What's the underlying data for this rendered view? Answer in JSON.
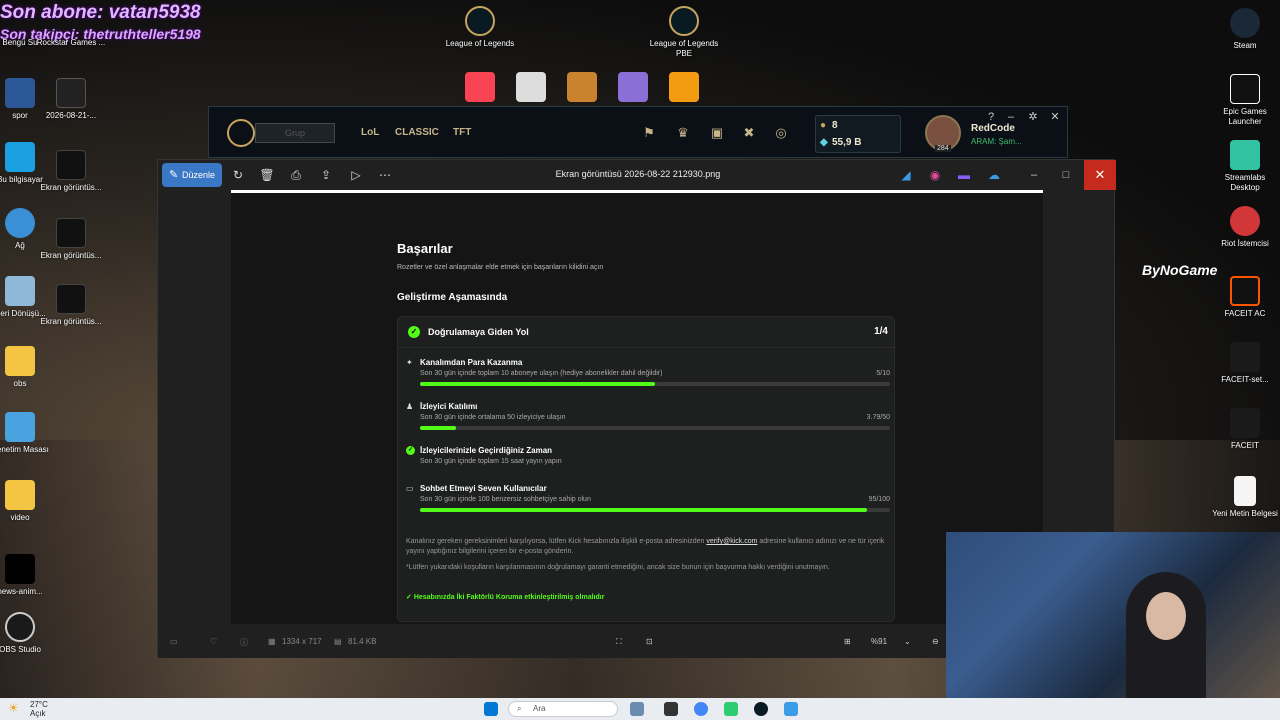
{
  "overlay": {
    "last_sub": "Son abone: vatan5938",
    "last_follow": "Son takipçi: thetruthteller5198"
  },
  "desktop_left": [
    {
      "label": "Bengü Su"
    },
    {
      "label": "Rockstar Games ..."
    },
    {
      "label": "spor"
    },
    {
      "label": "2026-08-21-..."
    },
    {
      "label": "Bu bilgisayar"
    },
    {
      "label": "Ekran görüntüs..."
    },
    {
      "label": "Ağ"
    },
    {
      "label": "Ekran görüntüs..."
    },
    {
      "label": "Geri Dönüşü..."
    },
    {
      "label": "Ekran görüntüs..."
    },
    {
      "label": "obs"
    },
    {
      "label": "Denetim Masası"
    },
    {
      "label": "video"
    },
    {
      "label": "news-anim..."
    },
    {
      "label": "OBS Studio"
    }
  ],
  "desktop_top": [
    {
      "label": "League of Legends"
    },
    {
      "label": "League of Legends PBE"
    }
  ],
  "desktop_right": [
    {
      "label": "Steam"
    },
    {
      "label": "Epic Games Launcher"
    },
    {
      "label": "Streamlabs Desktop"
    },
    {
      "label": "Riot İstemcisi"
    },
    {
      "label": "FACEIT AC"
    },
    {
      "label": "FACEIT-set..."
    },
    {
      "label": "FACEIT"
    },
    {
      "label": "Yeni Metin Belgesi"
    }
  ],
  "bynogame": "ByNoGame",
  "lol": {
    "party": "Grup",
    "tabs": [
      "LoL",
      "CLASSIC",
      "TFT"
    ],
    "currency1": "8",
    "currency2": "55,9 B",
    "level": "284",
    "summoner": "RedCode",
    "status": "ARAM: Şam..."
  },
  "viewer": {
    "edit_label": "Düzenle",
    "title": "Ekran görüntüsü 2026-08-22 212930.png",
    "dimensions": "1334 x 717",
    "filesize": "81.4 KB",
    "zoom": "%91"
  },
  "kick": {
    "title": "Başarılar",
    "subtitle": "Rozetler ve özel anlaşmalar elde etmek için başarıların kilidini açın",
    "section": "Geliştirme Aşamasında",
    "card_title": "Doğrulamaya Giden Yol",
    "card_count": "1/4",
    "requirements": [
      {
        "name": "Kanalımdan Para Kazanma",
        "desc": "Son 30 gün içinde toplam 10 aboneye ulaşın (hediye abonelikler dahil değildir)",
        "value": "5/10",
        "progress": 0.5,
        "icon": "money-icon"
      },
      {
        "name": "İzleyici Katılımı",
        "desc": "Son 30 gün içinde ortalama 50 izleyiciye ulaşın",
        "value": "3.79/50",
        "progress": 0.076,
        "icon": "viewers-icon"
      },
      {
        "name": "İzleyicilerinizle Geçirdiğiniz Zaman",
        "desc": "Son 30 gün içinde toplam 15 saat yayın yapın",
        "value": "",
        "progress": null,
        "icon": "check-icon"
      },
      {
        "name": "Sohbet Etmeyi Seven Kullanıcılar",
        "desc": "Son 30 gün içinde 100 benzersiz sohbetçiye sahip olun",
        "value": "95/100",
        "progress": 0.95,
        "icon": "chat-icon"
      }
    ],
    "note1_a": "Kanalınız gereken gereksinimleri karşılıyorsa, lütfen Kick hesabınızla ilişkili e-posta adresinizden ",
    "note1_link": "verify@kick.com",
    "note1_b": " adresine kullanıcı adınızı ve ne tür içerik yayını yaptığınız bilgilerini içeren bir e-posta gönderin.",
    "note2": "*Lütfen yukarıdaki koşulların karşılanmasının doğrulamayı garanti etmediğini, ancak size bunun için başvurma hakkı verdiğini unutmayın.",
    "twofa": "Hesabınızda İki Faktörlü Koruma etkinleştirilmiş olmalıdır"
  },
  "taskbar": {
    "temp": "27°C",
    "weather": "Açık",
    "search_placeholder": "Ara"
  },
  "colors": {
    "kick_green": "#53fc18",
    "edit_blue": "#3a78c6",
    "close_red": "#c42b1c"
  }
}
